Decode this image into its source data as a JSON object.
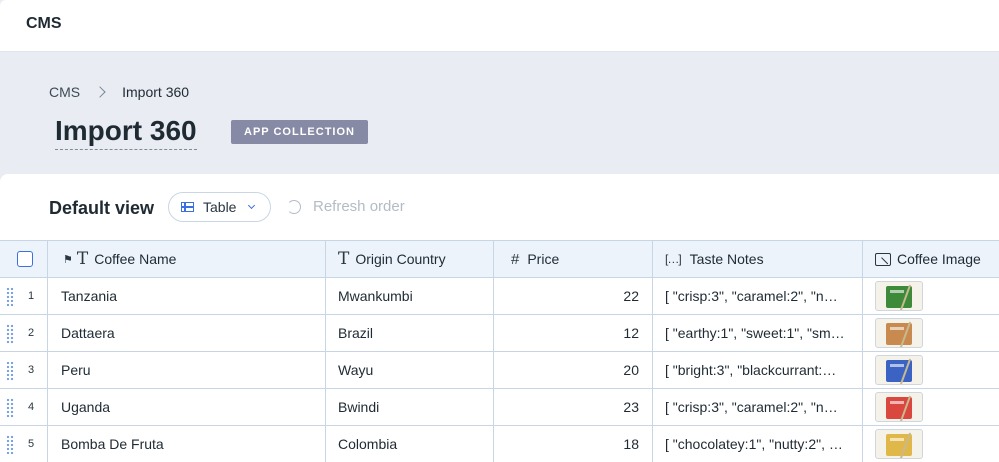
{
  "app": {
    "title": "CMS"
  },
  "breadcrumb": {
    "root": "CMS",
    "current": "Import 360"
  },
  "page": {
    "title": "Import 360",
    "badge": "APP COLLECTION"
  },
  "view": {
    "title": "Default view",
    "table_label": "Table",
    "refresh_label": "Refresh order"
  },
  "table": {
    "columns": [
      {
        "label": "Coffee Name",
        "icon": "text-field-icon"
      },
      {
        "label": "Origin Country",
        "icon": "text-field-icon"
      },
      {
        "label": "Price",
        "icon": "number-field-icon"
      },
      {
        "label": "Taste Notes",
        "icon": "array-field-icon"
      },
      {
        "label": "Coffee Image",
        "icon": "image-field-icon"
      }
    ],
    "rows": [
      {
        "num": "1",
        "name": "Tanzania",
        "origin": "Mwankumbi",
        "price": "22",
        "notes": "[ \"crisp:3\", \"caramel:2\", \"nu…",
        "image_color": "#3d8b3a"
      },
      {
        "num": "2",
        "name": "Dattaera",
        "origin": "Brazil",
        "price": "12",
        "notes": "[ \"earthy:1\", \"sweet:1\", \"sm…",
        "image_color": "#c98a4f"
      },
      {
        "num": "3",
        "name": "Peru",
        "origin": "Wayu",
        "price": "20",
        "notes": "[ \"bright:3\", \"blackcurrant:…",
        "image_color": "#3b63c4"
      },
      {
        "num": "4",
        "name": "Uganda",
        "origin": "Bwindi",
        "price": "23",
        "notes": "[ \"crisp:3\", \"caramel:2\", \"nu…",
        "image_color": "#d9473f"
      },
      {
        "num": "5",
        "name": "Bomba De Fruta",
        "origin": "Colombia",
        "price": "18",
        "notes": "[ \"chocolatey:1\", \"nutty:2\", \"…",
        "image_color": "#e0b84a"
      }
    ]
  },
  "colors": {
    "accent": "#3c6fe0",
    "badge_bg": "#868aa5",
    "header_bg": "#e9edf3"
  }
}
